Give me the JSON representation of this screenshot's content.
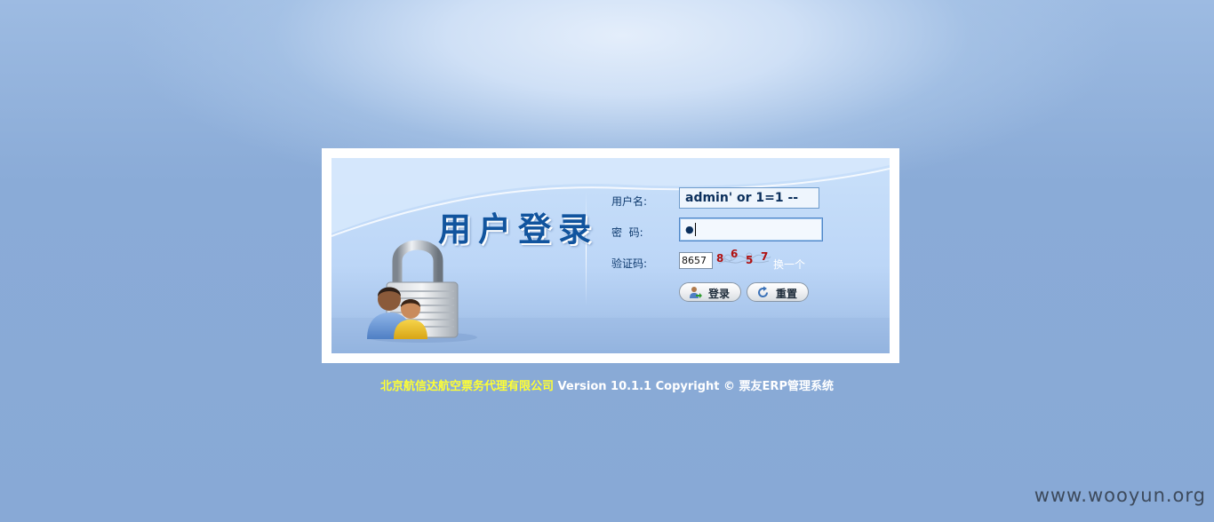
{
  "login": {
    "title": "用户登录",
    "username_label": "用户名:",
    "username_value": "admin' or 1=1 --",
    "password_label": "密  码:",
    "password_mask": "●",
    "captcha_label": "验证码:",
    "captcha_value": "8657",
    "captcha_image_text": "8657",
    "captcha_refresh": "换一个",
    "login_button": "登录",
    "reset_button": "重置"
  },
  "footer": {
    "company": "北京航信达航空票务代理有限公司",
    "version_text": " Version 10.1.1 Copyright © 票友ERP管理系统"
  },
  "watermark": "www.wooyun.org",
  "colors": {
    "background": "#8aabd7",
    "title": "#11549e",
    "company_text": "#ffff33"
  }
}
